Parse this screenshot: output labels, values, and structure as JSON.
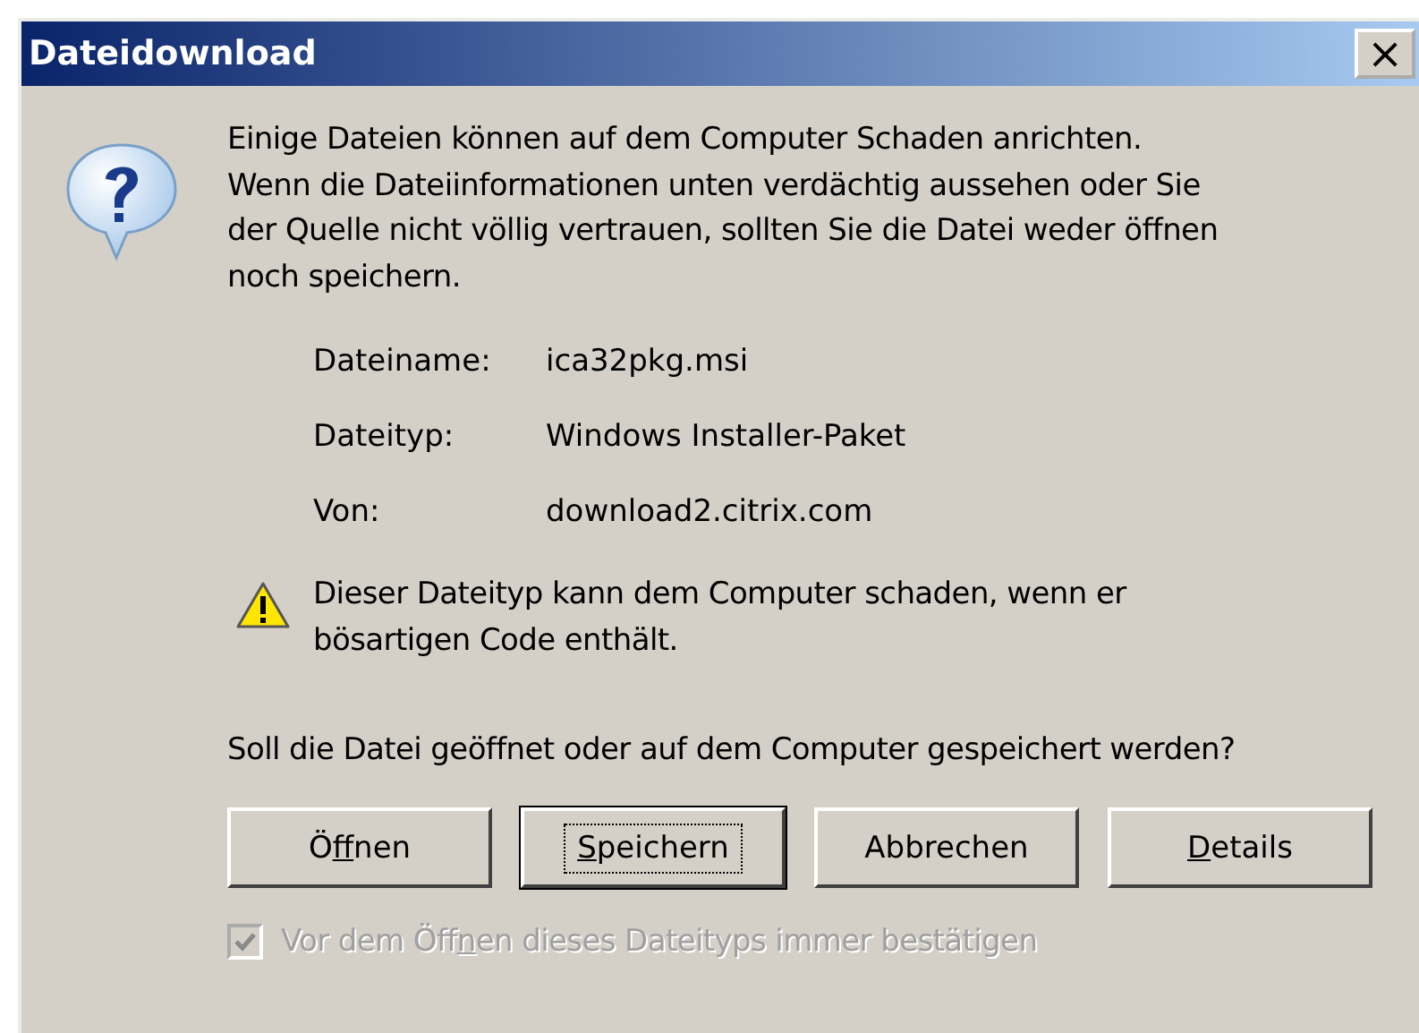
{
  "window": {
    "title": "Dateidownload",
    "close": "×"
  },
  "message": "Einige Dateien können auf dem Computer Schaden anrichten.\nWenn die Dateiinformationen unten verdächtig aussehen oder Sie\nder Quelle nicht völlig vertrauen, sollten Sie die Datei weder öffnen\nnoch speichern.",
  "details": [
    {
      "label": "Dateiname:",
      "value": "ica32pkg.msi"
    },
    {
      "label": "Dateityp:",
      "value": "Windows Installer-Paket"
    },
    {
      "label": "Von:",
      "value": "download2.citrix.com"
    }
  ],
  "warning": "Dieser Dateityp kann dem Computer schaden, wenn er\nbösartigen Code enthält.",
  "question": "Soll die Datei geöffnet oder auf dem Computer gespeichert werden?",
  "buttons": [
    {
      "before": "Ö",
      "key": "f",
      "after": "fnen",
      "default": false
    },
    {
      "key": "S",
      "after": "peichern",
      "default": true
    },
    {
      "before": "Abbrechen",
      "default": false
    },
    {
      "key": "D",
      "after": "etails",
      "default": false
    }
  ],
  "confirm": {
    "before": "Vor dem Öff",
    "key": "n",
    "after": "en dieses Dateityps immer bestätigen",
    "checked": true,
    "disabled": true
  }
}
